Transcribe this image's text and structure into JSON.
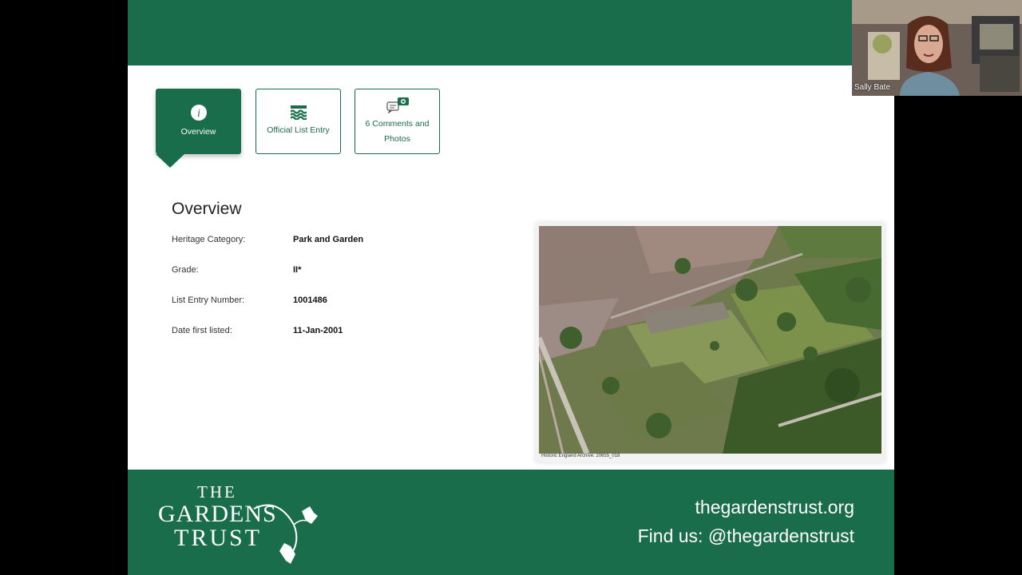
{
  "tabs": [
    {
      "label": "Overview",
      "icon": "info-icon",
      "active": true
    },
    {
      "label": "Official List Entry",
      "icon": "waves-icon",
      "active": false
    },
    {
      "label": "6 Comments and Photos",
      "icon": "comments-camera-icon",
      "active": false
    }
  ],
  "overview": {
    "title": "Overview",
    "rows": [
      {
        "key": "Heritage Category:",
        "value": "Park and Garden"
      },
      {
        "key": "Grade:",
        "value": "II*"
      },
      {
        "key": "List Entry Number:",
        "value": "1001486"
      },
      {
        "key": "Date first listed:",
        "value": "11-Jan-2001"
      }
    ]
  },
  "photo": {
    "credit": "Historic England Archive: 20655_018"
  },
  "footer": {
    "logo": {
      "line1": "THE",
      "line2": "GARDENS",
      "line3": "TRUST"
    },
    "url": "thegardenstrust.org",
    "social": "Find us: @thegardenstrust"
  },
  "webcam": {
    "participant_name": "Sally Bate"
  },
  "colors": {
    "brand_green": "#1a6d4a",
    "background": "#000000"
  }
}
